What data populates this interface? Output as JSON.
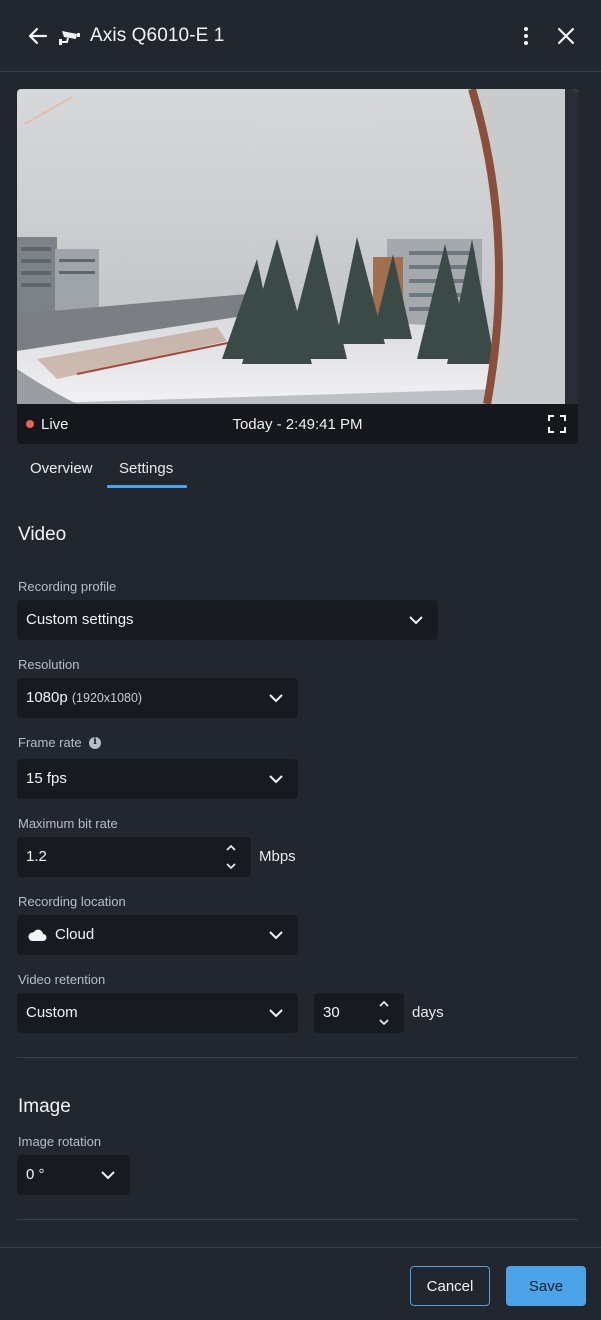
{
  "header": {
    "title": "Axis Q6010-E 1",
    "icons": {
      "back": "arrow-left-icon",
      "camera": "security-camera-icon",
      "more": "vertical-dots-icon",
      "close": "close-icon"
    }
  },
  "preview": {
    "live_label": "Live",
    "timestamp": "Today - 2:49:41 PM",
    "live_color": "#e5675a"
  },
  "tabs": [
    {
      "label": "Overview",
      "active": false
    },
    {
      "label": "Settings",
      "active": true
    }
  ],
  "video": {
    "section_title": "Video",
    "recording_profile": {
      "label": "Recording profile",
      "value": "Custom settings"
    },
    "resolution": {
      "label": "Resolution",
      "value": "1080p",
      "detail": "(1920x1080)"
    },
    "frame_rate": {
      "label": "Frame rate",
      "value": "15 fps"
    },
    "max_bit_rate": {
      "label": "Maximum bit rate",
      "value": "1.2",
      "unit": "Mbps"
    },
    "recording_location": {
      "label": "Recording location",
      "value": "Cloud"
    },
    "video_retention": {
      "label": "Video retention",
      "value": "Custom",
      "days_value": "30",
      "days_unit": "days"
    }
  },
  "image": {
    "section_title": "Image",
    "image_rotation": {
      "label": "Image rotation",
      "value": "0 °"
    }
  },
  "footer": {
    "cancel_label": "Cancel",
    "save_label": "Save"
  },
  "colors": {
    "accent": "#4ca3e8",
    "background": "#22262f",
    "field_background": "#171a21"
  }
}
